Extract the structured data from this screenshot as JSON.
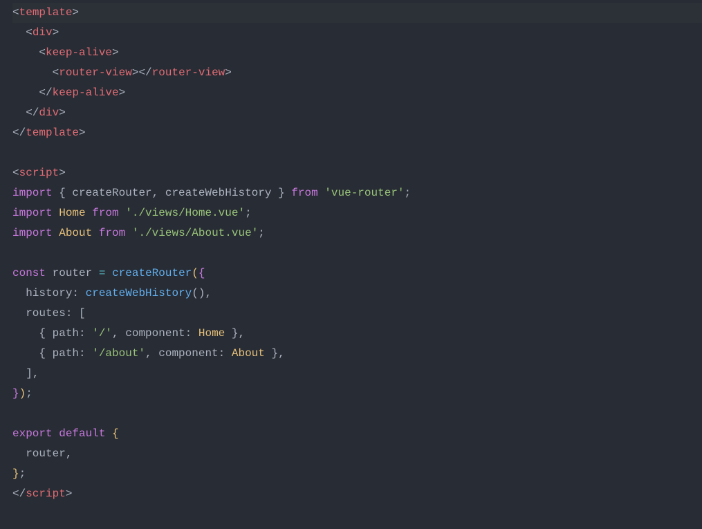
{
  "code": {
    "l1": {
      "open": "<",
      "tag": "template",
      "close": ">"
    },
    "l2": {
      "indent": "  ",
      "open": "<",
      "tag": "div",
      "close": ">"
    },
    "l3": {
      "indent": "    ",
      "open": "<",
      "tag": "keep-alive",
      "close": ">"
    },
    "l4": {
      "indent": "      ",
      "open": "<",
      "tag": "router-view",
      "close": ">",
      "open2": "</",
      "tag2": "router-view",
      "close2": ">"
    },
    "l5": {
      "indent": "    ",
      "open": "</",
      "tag": "keep-alive",
      "close": ">"
    },
    "l6": {
      "indent": "  ",
      "open": "</",
      "tag": "div",
      "close": ">"
    },
    "l7": {
      "open": "</",
      "tag": "template",
      "close": ">"
    },
    "l8": "",
    "l9": {
      "open": "<",
      "tag": "script",
      "close": ">"
    },
    "l10": {
      "kw": "import",
      "sp": " ",
      "br1": "{ ",
      "i1": "createRouter",
      "c": ", ",
      "i2": "createWebHistory",
      "br2": " }",
      "sp2": " ",
      "from": "from",
      "sp3": " ",
      "str": "'vue-router'",
      "semi": ";"
    },
    "l11": {
      "kw": "import",
      "sp": " ",
      "cls": "Home",
      "sp2": " ",
      "from": "from",
      "sp3": " ",
      "str": "'./views/Home.vue'",
      "semi": ";"
    },
    "l12": {
      "kw": "import",
      "sp": " ",
      "cls": "About",
      "sp2": " ",
      "from": "from",
      "sp3": " ",
      "str": "'./views/About.vue'",
      "semi": ";"
    },
    "l13": "",
    "l14": {
      "kw": "const",
      "sp": " ",
      "id": "router",
      "sp2": " ",
      "assign": "=",
      "sp3": " ",
      "fn": "createRouter",
      "p": "(",
      "br": "{"
    },
    "l15": {
      "indent": "  ",
      "key": "history",
      "colon": ": ",
      "fn": "createWebHistory",
      "p": "()",
      "c": ","
    },
    "l16": {
      "indent": "  ",
      "key": "routes",
      "colon": ": ",
      "br": "["
    },
    "l17": {
      "indent": "    ",
      "br1": "{ ",
      "key1": "path",
      "colon1": ": ",
      "str1": "'/'",
      "c1": ", ",
      "key2": "component",
      "colon2": ": ",
      "cls": "Home",
      "br2": " }",
      "c": ","
    },
    "l18": {
      "indent": "    ",
      "br1": "{ ",
      "key1": "path",
      "colon1": ": ",
      "str1": "'/about'",
      "c1": ", ",
      "key2": "component",
      "colon2": ": ",
      "cls": "About",
      "br2": " }",
      "c": ","
    },
    "l19": {
      "indent": "  ",
      "br": "]",
      "c": ","
    },
    "l20": {
      "br": "}",
      "p": ")",
      "semi": ";"
    },
    "l21": "",
    "l22": {
      "kw1": "export",
      "sp": " ",
      "kw2": "default",
      "sp2": " ",
      "br": "{"
    },
    "l23": {
      "indent": "  ",
      "id": "router",
      "c": ","
    },
    "l24": {
      "br": "}",
      "semi": ";"
    },
    "l25": {
      "open": "</",
      "tag": "script",
      "close": ">"
    }
  }
}
